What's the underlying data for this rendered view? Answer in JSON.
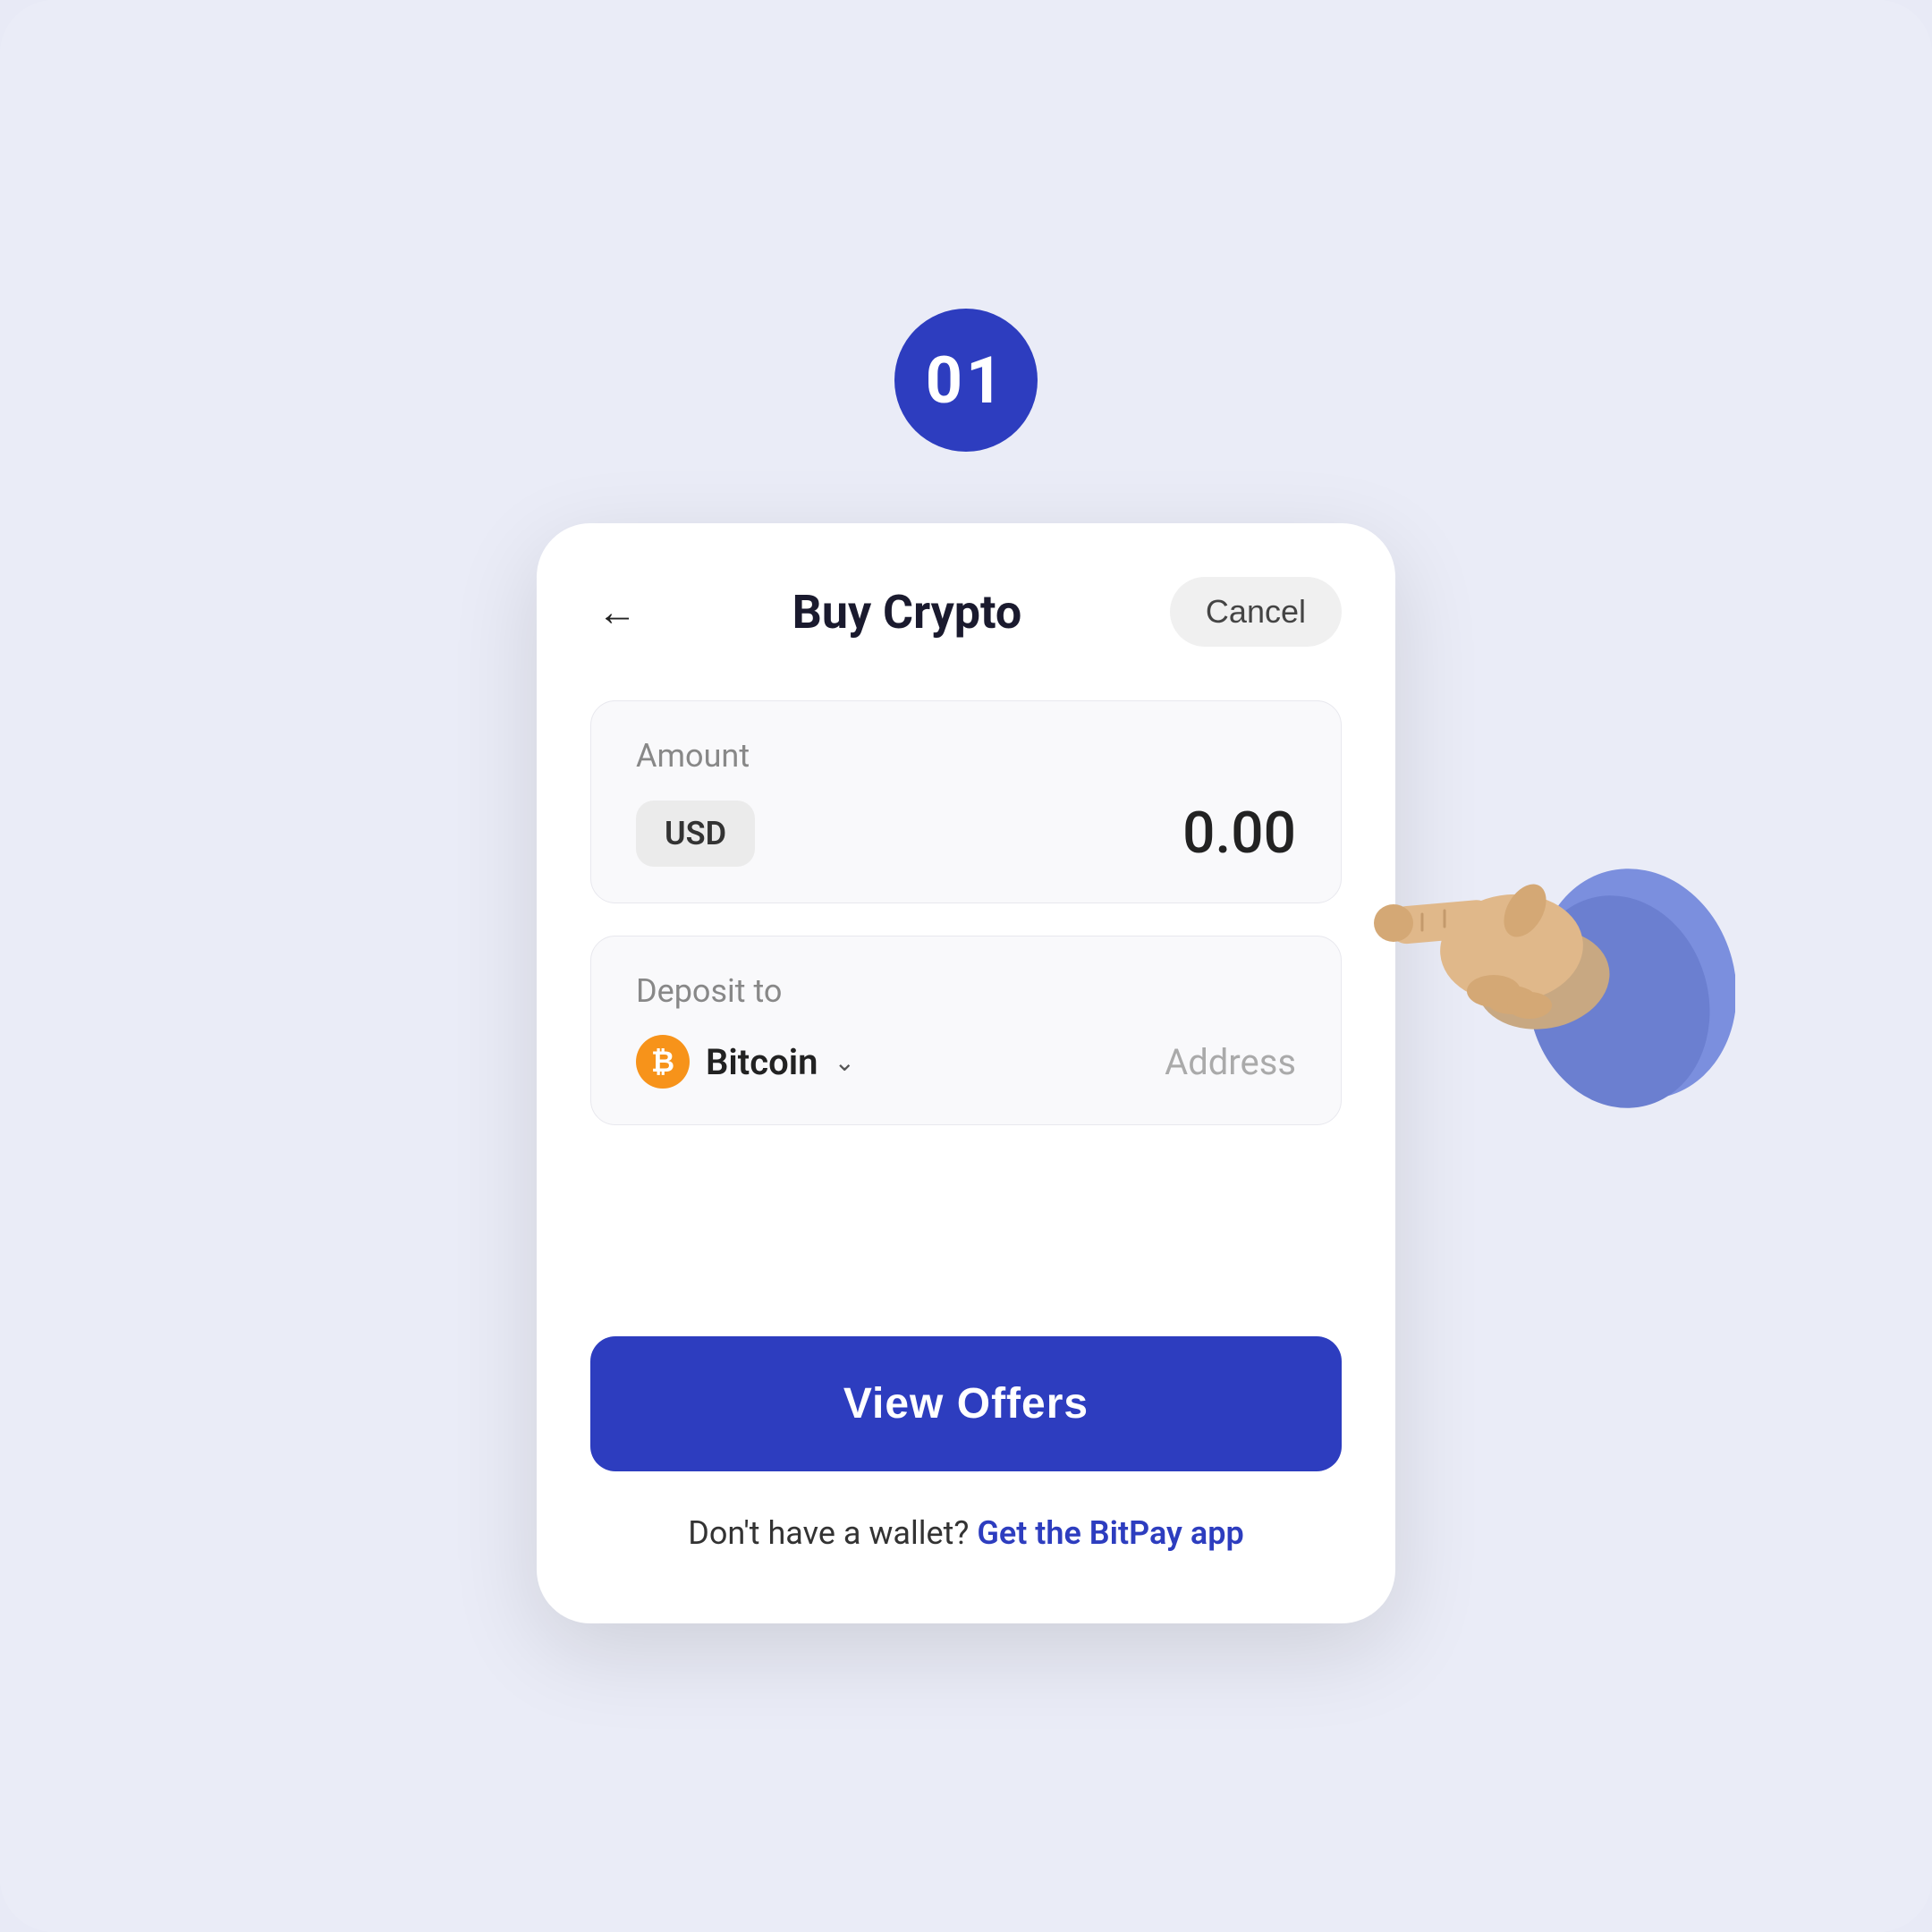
{
  "step": {
    "number": "01"
  },
  "header": {
    "title": "Buy Crypto",
    "cancel_label": "Cancel",
    "back_label": "←"
  },
  "amount_section": {
    "label": "Amount",
    "currency": "USD",
    "value": "0.00"
  },
  "deposit_section": {
    "label": "Deposit to",
    "coin": "Bitcoin",
    "address_placeholder": "Address",
    "chevron": "⌄"
  },
  "cta": {
    "view_offers_label": "View Offers"
  },
  "footer": {
    "no_wallet_text": "Don't have a wallet?",
    "get_app_link": "Get the BitPay app"
  }
}
